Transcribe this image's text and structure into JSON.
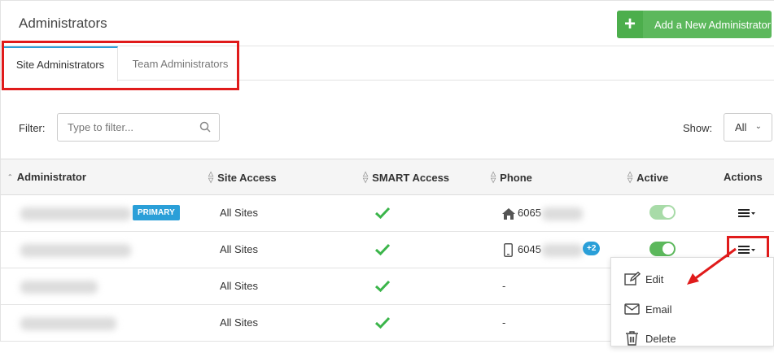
{
  "header": {
    "title": "Administrators",
    "add_button_label": "Add a New Administrator"
  },
  "tabs": [
    {
      "label": "Site Administrators",
      "active": true
    },
    {
      "label": "Team Administrators",
      "active": false
    }
  ],
  "filter": {
    "label": "Filter:",
    "placeholder": "Type to filter..."
  },
  "show": {
    "label": "Show:",
    "value": "All"
  },
  "table": {
    "columns": [
      "Administrator",
      "Site Access",
      "SMART Access",
      "Phone",
      "Active",
      "Actions"
    ],
    "rows": [
      {
        "badge": "PRIMARY",
        "site_access": "All Sites",
        "phone_icon": "home-icon",
        "phone": "6065",
        "extra": "",
        "active": true
      },
      {
        "badge": "",
        "site_access": "All Sites",
        "phone_icon": "mobile-icon",
        "phone": "6045",
        "extra": "+2",
        "active": true
      },
      {
        "badge": "",
        "site_access": "All Sites",
        "phone_icon": "",
        "phone": "-",
        "extra": "",
        "active": false
      },
      {
        "badge": "",
        "site_access": "All Sites",
        "phone_icon": "",
        "phone": "-",
        "extra": "",
        "active": false
      }
    ]
  },
  "actions_menu": {
    "edit": "Edit",
    "email": "Email",
    "delete": "Delete"
  },
  "colors": {
    "accent": "#2a9fd8",
    "green": "#5cb85c",
    "check": "#3bb54a",
    "annotation": "#e01b1b"
  }
}
